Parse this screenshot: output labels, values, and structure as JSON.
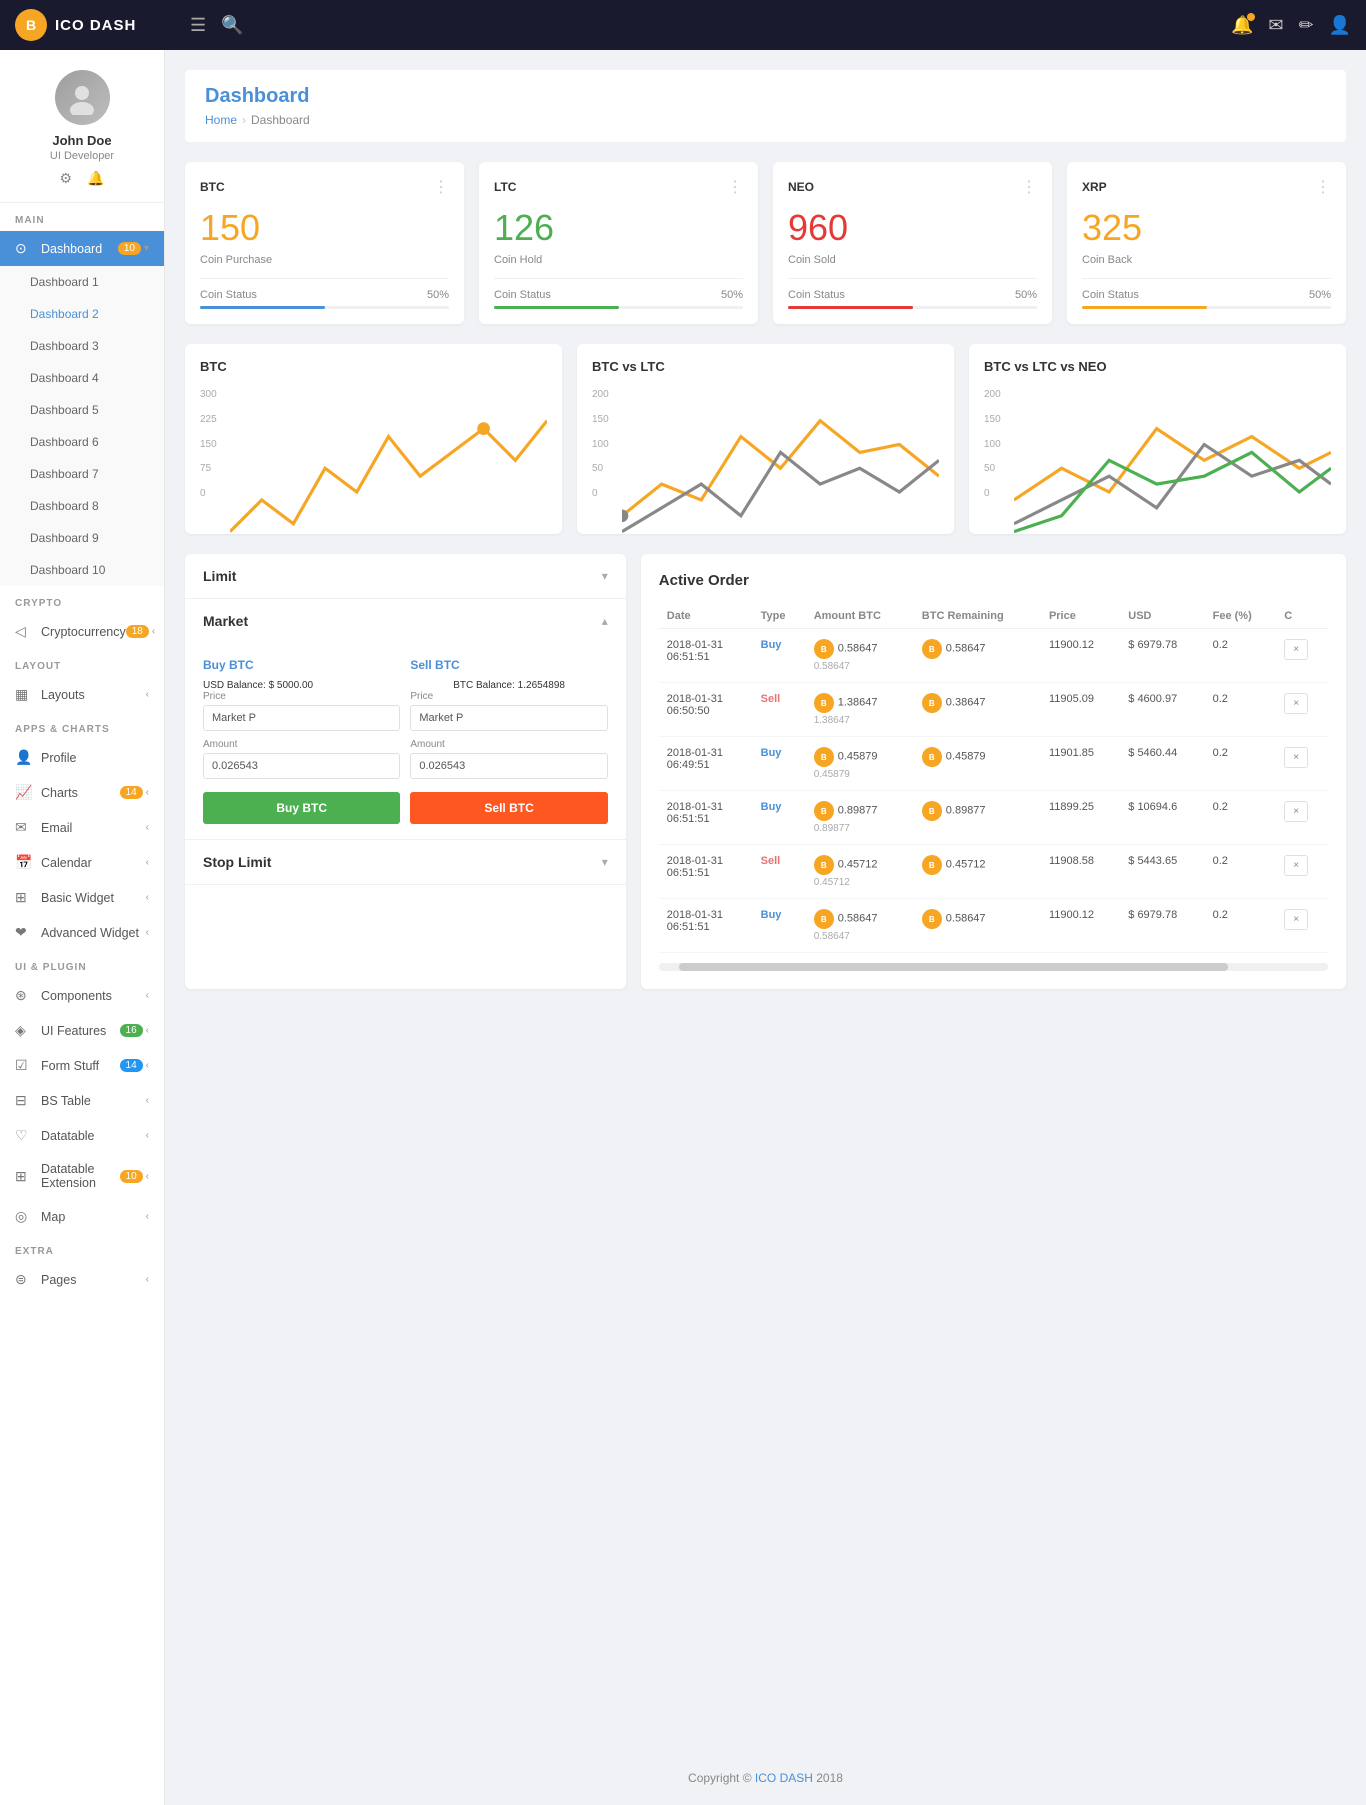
{
  "brand": {
    "icon": "B",
    "text": "ICO DASH"
  },
  "topnav": {
    "menu_icon": "☰",
    "search_icon": "🔍"
  },
  "sidebar": {
    "profile": {
      "name": "John Doe",
      "role": "UI Developer"
    },
    "sections": [
      {
        "label": "MAIN",
        "items": [
          {
            "id": "dashboard",
            "icon": "⊙",
            "label": "Dashboard",
            "badge": "10",
            "active": true,
            "has_arrow": true,
            "has_badge": true
          },
          {
            "id": "dashboard-1",
            "label": "Dashboard 1",
            "sub": true
          },
          {
            "id": "dashboard-2",
            "label": "Dashboard 2",
            "sub": true,
            "active_sub": true
          },
          {
            "id": "dashboard-3",
            "label": "Dashboard 3",
            "sub": true
          },
          {
            "id": "dashboard-4",
            "label": "Dashboard 4",
            "sub": true
          },
          {
            "id": "dashboard-5",
            "label": "Dashboard 5",
            "sub": true
          },
          {
            "id": "dashboard-6",
            "label": "Dashboard 6",
            "sub": true
          },
          {
            "id": "dashboard-7",
            "label": "Dashboard 7",
            "sub": true
          },
          {
            "id": "dashboard-8",
            "label": "Dashboard 8",
            "sub": true
          },
          {
            "id": "dashboard-9",
            "label": "Dashboard 9",
            "sub": true
          },
          {
            "id": "dashboard-10",
            "label": "Dashboard 10",
            "sub": true
          }
        ]
      },
      {
        "label": "CRYPTO",
        "items": [
          {
            "id": "cryptocurrency",
            "icon": "◁",
            "label": "Cryptocurrency",
            "badge": "18",
            "has_arrow": true,
            "has_badge": true
          }
        ]
      },
      {
        "label": "LAYOUT",
        "items": [
          {
            "id": "layouts",
            "icon": "▦",
            "label": "Layouts",
            "has_arrow": true
          }
        ]
      },
      {
        "label": "APPS & CHARTS",
        "items": [
          {
            "id": "profile",
            "icon": "👤",
            "label": "Profile"
          },
          {
            "id": "charts",
            "icon": "📈",
            "label": "Charts",
            "badge": "14",
            "has_badge": true,
            "has_arrow": true
          },
          {
            "id": "email",
            "icon": "✉",
            "label": "Email",
            "has_arrow": true
          },
          {
            "id": "calendar",
            "icon": "📅",
            "label": "Calendar",
            "has_arrow": true
          },
          {
            "id": "basic-widget",
            "icon": "⊞",
            "label": "Basic Widget",
            "has_arrow": true
          },
          {
            "id": "advanced-widget",
            "icon": "❤",
            "label": "Advanced Widget",
            "has_arrow": true
          }
        ]
      },
      {
        "label": "UI & PLUGIN",
        "items": [
          {
            "id": "components",
            "icon": "⊛",
            "label": "Components",
            "has_arrow": true
          },
          {
            "id": "ui-features",
            "icon": "◈",
            "label": "UI Features",
            "badge": "16",
            "has_badge": true,
            "has_arrow": true
          },
          {
            "id": "form-stuff",
            "icon": "☑",
            "label": "Form Stuff",
            "badge": "14",
            "has_badge": true,
            "has_arrow": true
          },
          {
            "id": "bs-table",
            "icon": "⊟",
            "label": "BS Table",
            "has_arrow": true
          },
          {
            "id": "datatable",
            "icon": "♡",
            "label": "Datatable",
            "has_arrow": true
          },
          {
            "id": "datatable-extension",
            "icon": "⊞",
            "label": "Datatable Extension",
            "badge": "10",
            "has_badge": true,
            "has_arrow": true
          },
          {
            "id": "map",
            "icon": "◎",
            "label": "Map",
            "has_arrow": true
          }
        ]
      },
      {
        "label": "EXTRA",
        "items": [
          {
            "id": "pages",
            "icon": "⊜",
            "label": "Pages",
            "has_arrow": true
          }
        ]
      }
    ]
  },
  "page": {
    "title": "Dashboard",
    "breadcrumb": {
      "home": "Home",
      "current": "Dashboard"
    }
  },
  "coin_cards": [
    {
      "id": "btc",
      "name": "BTC",
      "value": "150",
      "label": "Coin Purchase",
      "status": "Coin Status",
      "percent": "50%",
      "color_class": "btc-color",
      "bar_class": "btc-bar"
    },
    {
      "id": "ltc",
      "name": "LTC",
      "value": "126",
      "label": "Coin Hold",
      "status": "Coin Status",
      "percent": "50%",
      "color_class": "ltc-color",
      "bar_class": "ltc-bar"
    },
    {
      "id": "neo",
      "name": "NEO",
      "value": "960",
      "label": "Coin Sold",
      "status": "Coin Status",
      "percent": "50%",
      "color_class": "neo-color",
      "bar_class": "neo-bar"
    },
    {
      "id": "xrp",
      "name": "XRP",
      "value": "325",
      "label": "Coin Back",
      "status": "Coin Status",
      "percent": "50%",
      "color_class": "xrp-color",
      "bar_class": "xrp-bar"
    }
  ],
  "charts": [
    {
      "id": "btc-chart",
      "title": "BTC",
      "y_labels": [
        "300",
        "225",
        "150",
        "75",
        "0"
      ],
      "color": "#f6a623"
    },
    {
      "id": "btc-ltc-chart",
      "title": "BTC vs LTC",
      "y_labels": [
        "200",
        "150",
        "100",
        "50",
        "0"
      ],
      "colors": [
        "#f6a623",
        "#888"
      ]
    },
    {
      "id": "btc-ltc-neo-chart",
      "title": "BTC vs LTC vs NEO",
      "y_labels": [
        "200",
        "150",
        "100",
        "50",
        "0"
      ],
      "colors": [
        "#f6a623",
        "#888",
        "#4caf50"
      ]
    }
  ],
  "trade": {
    "limit_label": "Limit",
    "market_label": "Market",
    "stop_limit_label": "Stop Limit",
    "buy_btc_label": "Buy BTC",
    "sell_btc_label": "Sell BTC",
    "usd_balance_label": "USD Balance:",
    "usd_balance_value": "$ 5000.00",
    "btc_balance_label": "BTC Balance:",
    "btc_balance_value": "1.2654898",
    "price_label": "Price",
    "amount_label": "Amount",
    "price_placeholder": "Market P",
    "amount_buy_value": "0.026543",
    "amount_sell_value": "0.026543",
    "sell_col_label": "Sell BTC"
  },
  "active_order": {
    "title": "Active Order",
    "columns": [
      "Date",
      "Type",
      "Amount BTC",
      "BTC Remaining",
      "Price",
      "USD",
      "Fee (%)",
      "C"
    ],
    "rows": [
      {
        "date": "2018-01-31\n06:51:51",
        "type": "Buy",
        "amount": "0.58647",
        "remaining": "0.58647",
        "price": "11900.12",
        "usd": "$ 6979.78",
        "fee": "0.2"
      },
      {
        "date": "2018-01-31\n06:50:50",
        "type": "Sell",
        "amount": "1.38647",
        "remaining": "0.38647",
        "price": "11905.09",
        "usd": "$ 4600.97",
        "fee": "0.2"
      },
      {
        "date": "2018-01-31\n06:49:51",
        "type": "Buy",
        "amount": "0.45879",
        "remaining": "0.45879",
        "price": "11901.85",
        "usd": "$ 5460.44",
        "fee": "0.2"
      },
      {
        "date": "2018-01-31\n06:51:51",
        "type": "Buy",
        "amount": "0.89877",
        "remaining": "0.89877",
        "price": "11899.25",
        "usd": "$ 10694.6",
        "fee": "0.2"
      },
      {
        "date": "2018-01-31\n06:51:51",
        "type": "Sell",
        "amount": "0.45712",
        "remaining": "0.45712",
        "price": "11908.58",
        "usd": "$ 5443.65",
        "fee": "0.2"
      },
      {
        "date": "2018-01-31\n06:51:51",
        "type": "Buy",
        "amount": "0.58647",
        "remaining": "0.58647",
        "price": "11900.12",
        "usd": "$ 6979.78",
        "fee": "0.2"
      }
    ]
  },
  "footer": {
    "text": "Copyright © ICO DASH 2018"
  }
}
